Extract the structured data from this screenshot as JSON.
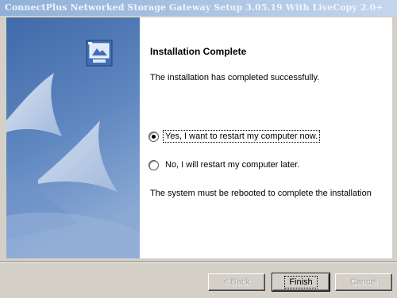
{
  "window": {
    "title": "ConnectPlus Networked Storage Gateway Setup 3.05.19 With LiveCopy 2.0+"
  },
  "page": {
    "heading": "Installation Complete",
    "description": "The installation has completed successfully.",
    "note": "The system must be rebooted to complete the installation"
  },
  "options": {
    "restart_now": "Yes, I want to restart my computer now.",
    "restart_later": "No, I will restart my computer later.",
    "selected": "restart_now"
  },
  "buttons": {
    "back": "< Back",
    "finish": "Finish",
    "cancel": "Cancel"
  },
  "colors": {
    "side_panel": "#4f76b0",
    "title_bar": "#8fb0d6"
  },
  "icons": {
    "setup": "setup-computer-icon"
  }
}
